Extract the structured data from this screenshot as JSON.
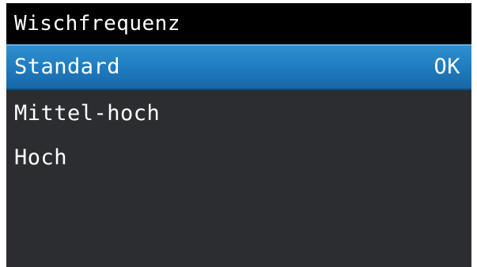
{
  "title": "Wischfrequenz",
  "menu": {
    "items": [
      {
        "label": "Standard",
        "selected": true,
        "status": "OK"
      },
      {
        "label": "Mittel-hoch",
        "selected": false
      },
      {
        "label": "Hoch",
        "selected": false
      }
    ]
  },
  "colors": {
    "title_bg": "#000000",
    "screen_bg": "#2b2d30",
    "selected_bg": "#1f7cc0",
    "text": "#ffffff"
  }
}
